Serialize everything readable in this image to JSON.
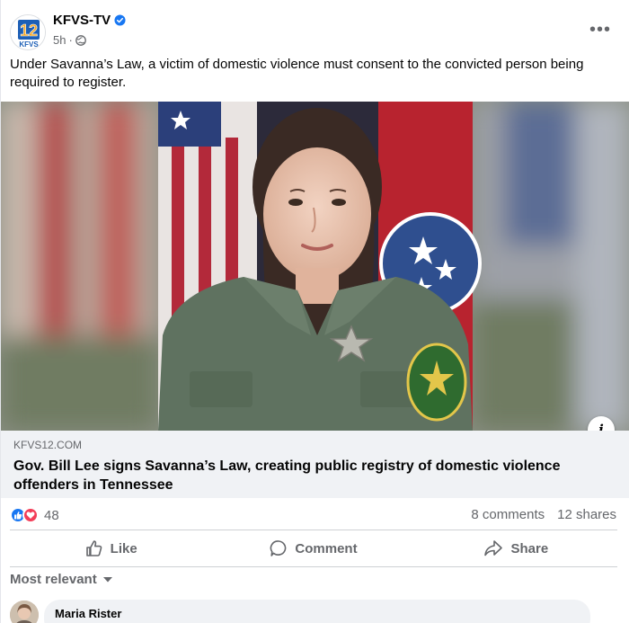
{
  "post": {
    "page_name": "KFVS-TV",
    "logo_text": "12",
    "logo_sub": "KFVS",
    "time": "5h",
    "visibility_icon": "globe-icon",
    "caption": "Under Savanna’s Law, a victim of domestic violence must consent to the convicted person being required to register.",
    "more_icon": "more-options-icon"
  },
  "link": {
    "domain": "KFVS12.COM",
    "title": "Gov. Bill Lee signs Savanna’s Law, creating public registry of domestic violence offenders in Tennessee"
  },
  "engagement": {
    "reaction_count": "48",
    "comments": "8 comments",
    "shares": "12 shares"
  },
  "actions": {
    "like": "Like",
    "comment": "Comment",
    "share": "Share"
  },
  "sort": {
    "label": "Most relevant"
  },
  "comments": [
    {
      "author": "Maria Rister"
    }
  ],
  "colors": {
    "accent": "#1877f2",
    "love": "#f33e58",
    "secondary_text": "#65676b",
    "link_bg": "#f0f2f5"
  }
}
